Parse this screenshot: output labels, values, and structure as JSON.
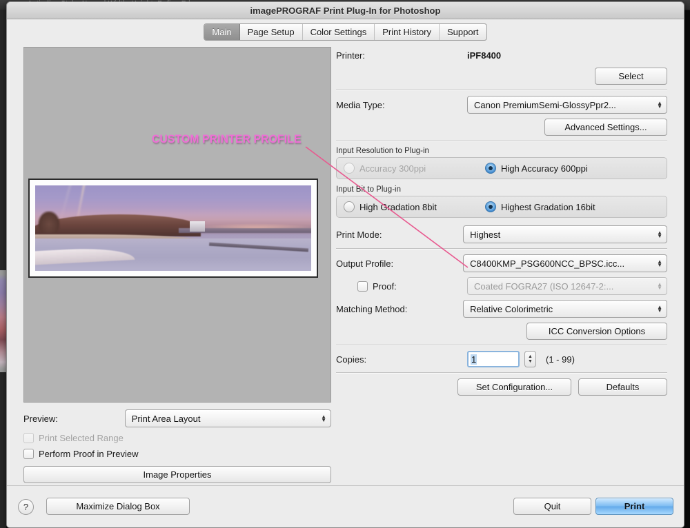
{
  "background": {
    "photoshop_toolbar_hint": "Anti-alias    Style:   Normal        Width:            Height:            Refine Edge..."
  },
  "window": {
    "title": "imagePROGRAF Print Plug-In for Photoshop"
  },
  "tabs": [
    {
      "label": "Main",
      "active": true
    },
    {
      "label": "Page Setup",
      "active": false
    },
    {
      "label": "Color Settings",
      "active": false
    },
    {
      "label": "Print History",
      "active": false
    },
    {
      "label": "Support",
      "active": false
    }
  ],
  "annotation": {
    "text": "CUSTOM PRINTER PROFILE",
    "color": "#ef6ed6",
    "line_color": "#e8598f"
  },
  "preview": {
    "label": "Preview:",
    "mode_value": "Print Area Layout",
    "print_selected_range_label": "Print Selected Range",
    "print_selected_range_checked": false,
    "print_selected_range_enabled": false,
    "perform_proof_label": "Perform Proof in Preview",
    "perform_proof_checked": false,
    "image_properties_button": "Image Properties"
  },
  "settings": {
    "printer_label": "Printer:",
    "printer_value": "iPF8400",
    "select_button": "Select",
    "media_type_label": "Media Type:",
    "media_type_value": "Canon PremiumSemi-GlossyPpr2...",
    "advanced_settings_button": "Advanced Settings...",
    "input_resolution_group": "Input Resolution to Plug-in",
    "input_resolution_options": [
      {
        "label": "Accuracy 300ppi",
        "selected": false,
        "enabled": false
      },
      {
        "label": "High Accuracy 600ppi",
        "selected": true,
        "enabled": true
      }
    ],
    "input_bit_group": "Input Bit to Plug-in",
    "input_bit_options": [
      {
        "label": "High Gradation 8bit",
        "selected": false,
        "enabled": true
      },
      {
        "label": "Highest Gradation 16bit",
        "selected": true,
        "enabled": true
      }
    ],
    "print_mode_label": "Print Mode:",
    "print_mode_value": "Highest",
    "output_profile_label": "Output Profile:",
    "output_profile_value": "C8400KMP_PSG600NCC_BPSC.icc...",
    "proof_label": "Proof:",
    "proof_checked": false,
    "proof_value": "Coated FOGRA27 (ISO 12647-2:...",
    "matching_method_label": "Matching Method:",
    "matching_method_value": "Relative Colorimetric",
    "icc_conversion_button": "ICC Conversion Options",
    "copies_label": "Copies:",
    "copies_value": "1",
    "copies_range_hint": "(1 - 99)",
    "set_configuration_button": "Set Configuration...",
    "defaults_button": "Defaults"
  },
  "footer": {
    "help_icon": "?",
    "maximize_button": "Maximize Dialog Box",
    "quit_button": "Quit",
    "print_button": "Print"
  }
}
